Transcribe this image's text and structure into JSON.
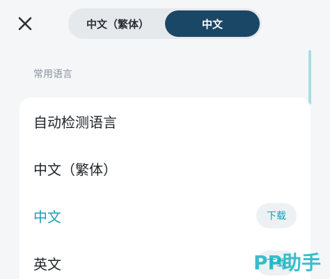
{
  "header": {
    "close_icon": "close-icon",
    "tabs": [
      {
        "label": "中文（繁体）",
        "active": false
      },
      {
        "label": "中文",
        "active": true
      }
    ]
  },
  "section": {
    "label": "常用语言"
  },
  "languages": [
    {
      "label": "自动检测语言",
      "selected": false
    },
    {
      "label": "中文（繁体）",
      "selected": false
    },
    {
      "label": "中文",
      "selected": true,
      "action": "下载"
    },
    {
      "label": "英文",
      "selected": false,
      "action": "下载"
    }
  ],
  "watermark": {
    "text": "PP助手"
  },
  "colors": {
    "accent": "#1aa0b5",
    "tab_active": "#1b4766",
    "background": "#f4f6f8"
  }
}
